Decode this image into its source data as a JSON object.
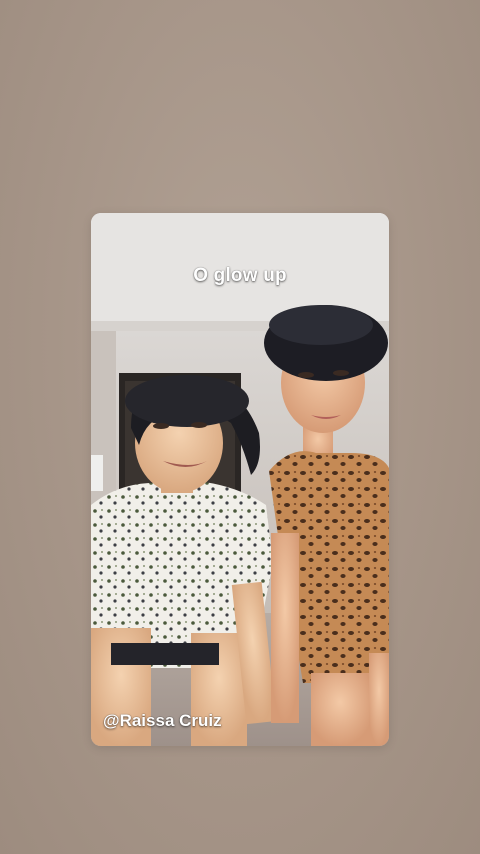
{
  "video": {
    "caption": "O glow up",
    "watermark_handle": "@Raissa Cruiz"
  },
  "colors": {
    "background": "#a8978a",
    "caption_text": "#ffffff"
  }
}
